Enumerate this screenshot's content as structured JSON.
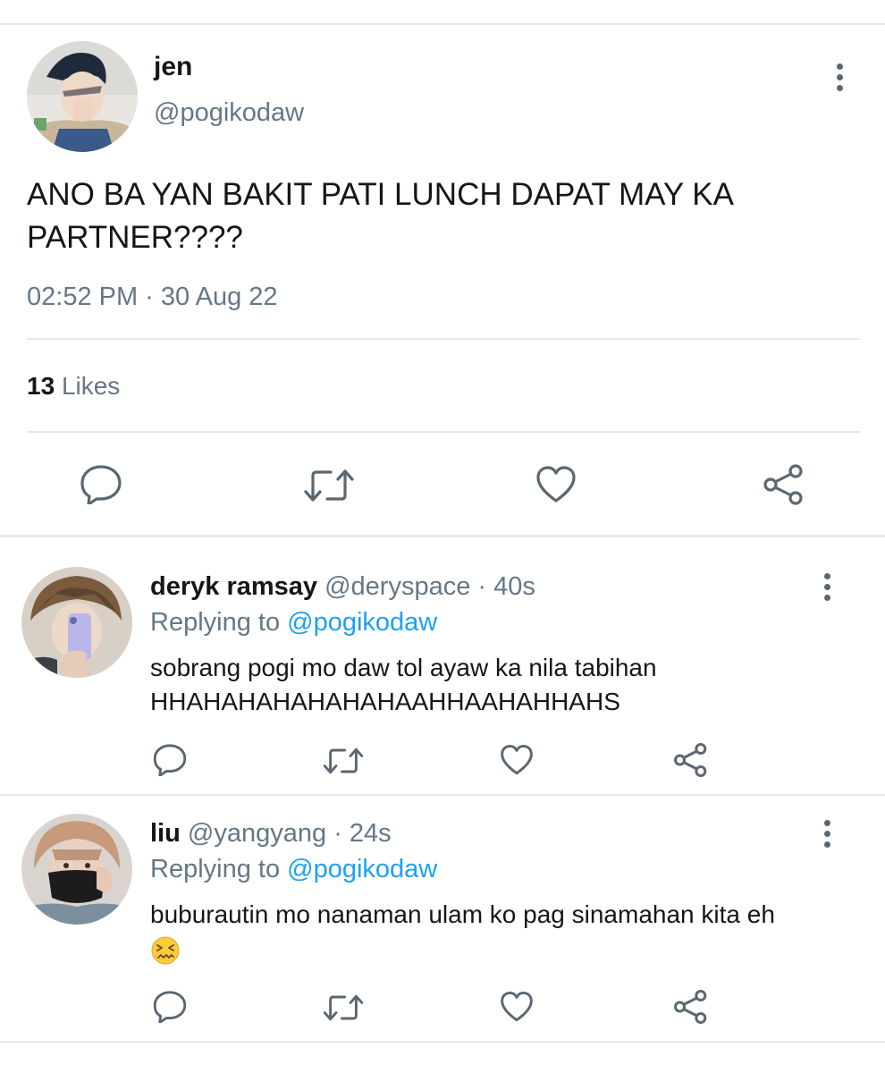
{
  "main_tweet": {
    "author_name": "jen",
    "author_handle": "@pogikodaw",
    "text": "ANO BA YAN BAKIT PATI LUNCH DAPAT MAY KA PARTNER????",
    "timestamp": "02:52 PM · 30 Aug 22",
    "likes_count": "13",
    "likes_label": "Likes"
  },
  "replies": [
    {
      "author_name": "deryk ramsay",
      "author_handle": "@deryspace",
      "time": "· 40s",
      "replying_prefix": "Replying to",
      "replying_mention": "@pogikodaw",
      "text_line1": "sobrang pogi mo daw tol ayaw ka nila tabihan",
      "text_line2": "HHAHAHAHAHAHAHAAHHAAHAHHAHS"
    },
    {
      "author_name": "liu",
      "author_handle": "@yangyang",
      "time": "· 24s",
      "replying_prefix": "Replying to",
      "replying_mention": "@pogikodaw",
      "text_line1": "buburautin mo nanaman ulam ko pag sinamahan kita eh",
      "emoji": "confounded-face-emoji"
    }
  ],
  "icons": {
    "reply": "reply-icon",
    "retweet": "retweet-icon",
    "like": "heart-icon",
    "share": "share-icon",
    "more": "more-vertical-icon"
  },
  "colors": {
    "text": "#14171a",
    "secondary": "#657786",
    "link": "#1da1f2",
    "divider": "#e1e8ed"
  }
}
